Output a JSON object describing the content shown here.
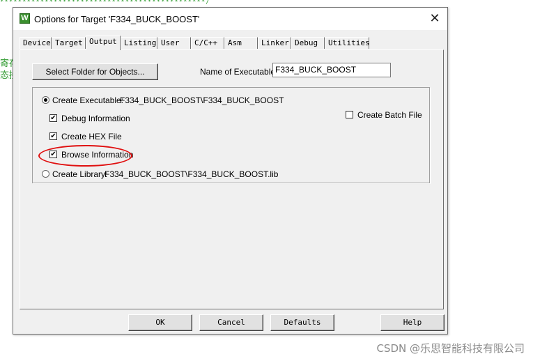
{
  "background": {
    "stars": "**********************************************/",
    "cjk_line1": "寄存",
    "cjk_line2": "态接"
  },
  "watermark": "CSDN @乐思智能科技有限公司",
  "dialog": {
    "title": "Options for Target 'F334_BUCK_BOOST'",
    "app_icon": "W",
    "close_label": "✕",
    "tabs": [
      {
        "label": "Device"
      },
      {
        "label": "Target"
      },
      {
        "label": "Output"
      },
      {
        "label": "Listing"
      },
      {
        "label": "User"
      },
      {
        "label": "C/C++"
      },
      {
        "label": "Asm"
      },
      {
        "label": "Linker"
      },
      {
        "label": "Debug"
      },
      {
        "label": "Utilities"
      }
    ],
    "active_tab": "Output",
    "select_folder_button": "Select Folder for Objects...",
    "name_of_executable_label": "Name of Executable:",
    "name_of_executable_value": "F334_BUCK_BOOST",
    "create_executable": {
      "label": "Create Executable:",
      "path": "F334_BUCK_BOOST\\F334_BUCK_BOOST",
      "selected": true
    },
    "debug_information": {
      "label": "Debug Information",
      "checked": true
    },
    "create_hex_file": {
      "label": "Create HEX File",
      "checked": true
    },
    "browse_information": {
      "label": "Browse Information",
      "checked": true
    },
    "create_batch_file": {
      "label": "Create Batch File",
      "checked": false
    },
    "create_library": {
      "label": "Create Library:",
      "path": "F334_BUCK_BOOST\\F334_BUCK_BOOST.lib",
      "selected": false
    },
    "buttons": {
      "ok": "OK",
      "cancel": "Cancel",
      "defaults": "Defaults",
      "help": "Help"
    },
    "check_mark": "✔",
    "highlight_color": "#e01010"
  }
}
